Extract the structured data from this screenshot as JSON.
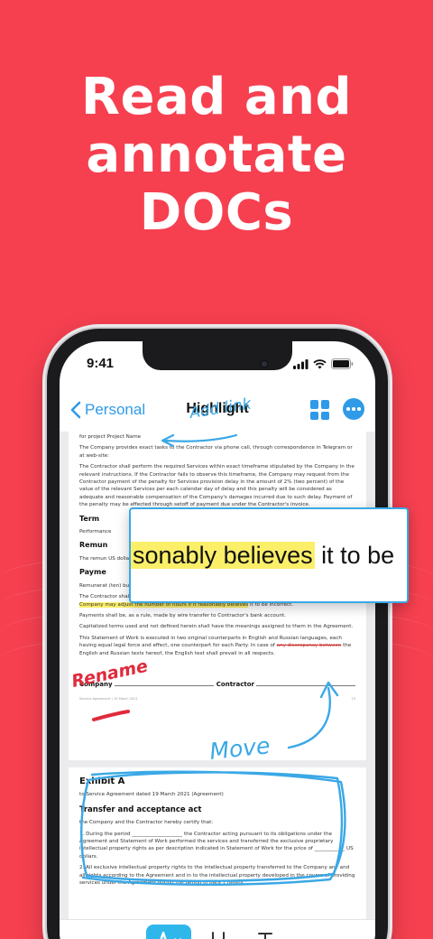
{
  "headline": {
    "line1": "Read and",
    "line2": "annotate",
    "line3": "DOCs"
  },
  "status_bar": {
    "time": "9:41"
  },
  "nav": {
    "back_label": "Personal",
    "title": "Highlight"
  },
  "document": {
    "page1": {
      "line0": "for project Project Name",
      "p1": "The Company provides exact tasks to the Contractor via phone call, through correspondence in Telegram or at web-site:",
      "p2": "The Contractor shall perform the required Services within exact timeframe stipulated by the Company in the relevant instructions. If the Contractor fails to observe this timeframe, the Company may request from the Contractor payment of the penalty for Services provision delay in the amount of 2% (two percent) of the value of the relevant Services per each calendar day of delay and this penalty will be considered as adequate and reasonable compensation of the Company's damages incurred due to such delay. Payment of the penalty may be effected through setoff of payment due under the Contractor's invoice.",
      "h_term": "Term",
      "p_term": "Performance",
      "h_remun": "Remun",
      "p_remun": "The remun US dollar",
      "h_payment": "Payme",
      "p_payment": "Remunerat (ten) busin multiplying above-mentioned hourly rate.",
      "p3": "The Contractor shall provide to the Company estimate of hours spent before issuing the invoice.",
      "p3_highlight": "The Company may adjust the number of hours if it reasonably believes",
      "p3_tail": " it to be incorrect.",
      "p4": "Payments shall be, as a rule, made by wire transfer to Contractor's bank account.",
      "p5": "Capitalized terms used and not defined herein shall have the meanings assigned to them in the Agreement.",
      "p6a": "This Statement of Work is executed in two original counterparts in English and Russian languages, each having equal legal force and effect, one counterpart for each Party. In case of ",
      "p6_strike": "any discrepancy between",
      "p6b": " the English and Russian texts hereof, the English text shall prevail in all respects.",
      "company_label": "Company",
      "contractor_label": "Contractor",
      "footer_left": "Service Agreement | 19 March 2021",
      "footer_right": "15"
    },
    "page2": {
      "title": "Exhibit A",
      "subtitle": "to Service Agreement dated 19 March 2021 (Agreement)",
      "heading": "Transfer and acceptance act",
      "p1": "the Company and the Contractor hereby certify that:",
      "p2": "1. During the period ____________________ the Contractor acting pursuant to its obligations under the Agreement and Statement of Work performed the services and transferred the exclusive proprietary intellectual property rights as per description indicated in Statement of Work for the price of ____________ US dollars.",
      "p3": "2. All exclusive intellectual property rights to the intellectual property transferred to the Company any and all rights according to the Agreement and in to the intellectual property developed in the course of providing services under the Agreement during the period in para 1 hereof."
    }
  },
  "zoom": {
    "pre": "sonably believes",
    "post": " it to be"
  },
  "annotations": {
    "add_link": "Add link",
    "rename": "Rename",
    "move": "Move"
  },
  "toolbar": {
    "highlight_icon": "highlight-pen-icon",
    "underline_icon": "underline-icon",
    "strike_icon": "strikethrough-icon"
  },
  "colors": {
    "background": "#f64050",
    "accent": "#2f9ae8",
    "highlight": "#fbef69",
    "annotation_blue": "#3aa8e6",
    "annotation_red": "#e02a3c"
  }
}
